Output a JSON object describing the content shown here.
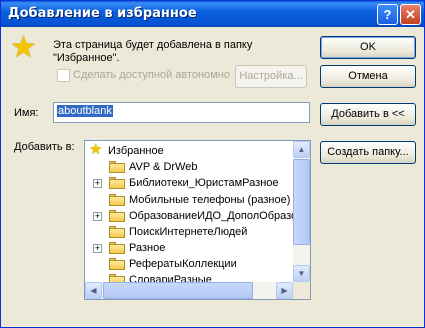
{
  "window": {
    "title": "Добавление в избранное",
    "help_button": "?",
    "close_button": "✕"
  },
  "message": {
    "line1": "Эта страница будет добавлена в папку",
    "line2": "\"Избранное\"."
  },
  "offline": {
    "checkbox_label": "Сделать доступной автономно",
    "checked": false,
    "customize_button": "Настройка..."
  },
  "name_field": {
    "label": "Имя:",
    "value": "aboutblank"
  },
  "add_to": {
    "label": "Добавить в:"
  },
  "buttons": {
    "ok": "OK",
    "cancel": "Отмена",
    "add_to_less": "Добавить в <<",
    "new_folder": "Создать папку..."
  },
  "tree": {
    "root": "Избранное",
    "items": [
      {
        "label": "AVP & DrWeb",
        "expandable": false
      },
      {
        "label": "Библиотеки_ЮристамРазное",
        "expandable": true
      },
      {
        "label": "Мобильные телефоны (разное)",
        "expandable": false
      },
      {
        "label": "ОбразованиеИДО_ДополОбразо",
        "expandable": true
      },
      {
        "label": "ПоискИнтернетеЛюдей",
        "expandable": false
      },
      {
        "label": "Разное",
        "expandable": true
      },
      {
        "label": "РефератыКоллекции",
        "expandable": false
      },
      {
        "label": "СловариРазные",
        "expandable": false
      }
    ]
  },
  "colors": {
    "title_bar": "#0a61e0",
    "selection": "#316ac5",
    "dialog_bg": "#ece9d8"
  }
}
